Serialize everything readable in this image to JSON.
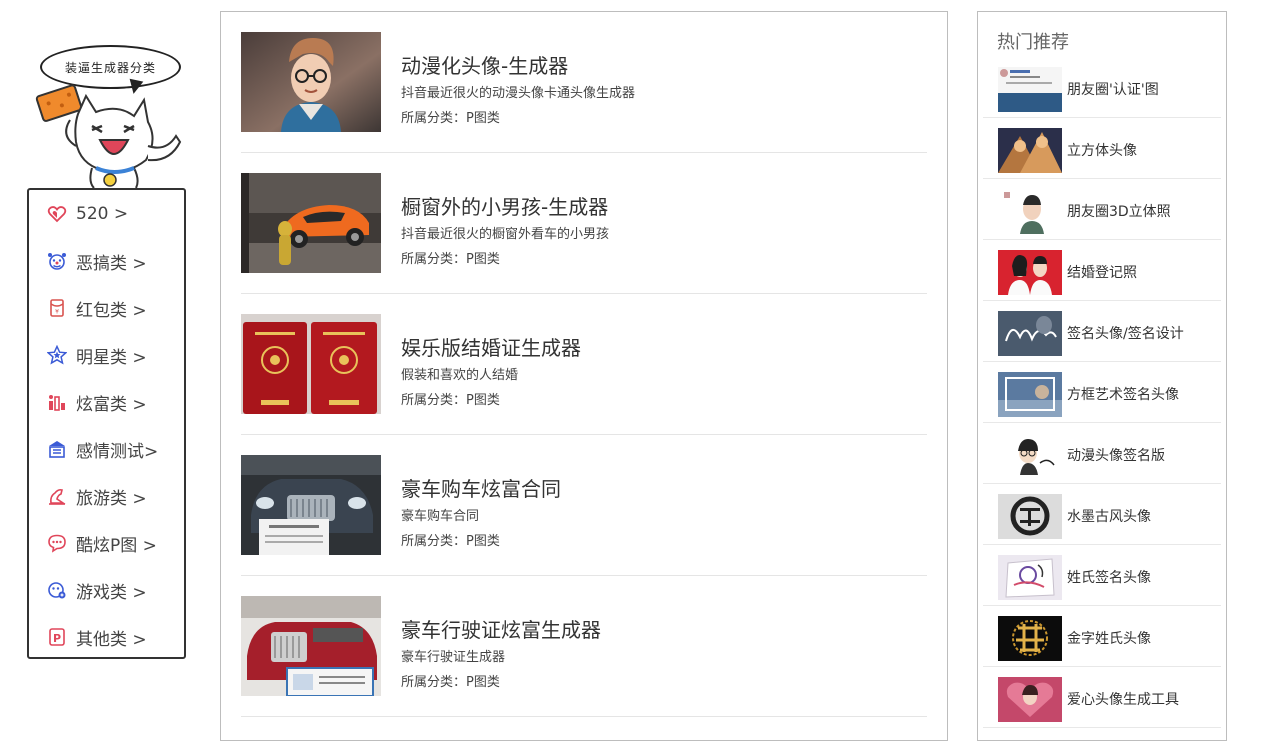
{
  "sidebar": {
    "bubble_text": "装逼生成器分类",
    "categories": [
      {
        "label": "520 >",
        "icon": "heart-icon",
        "color": "#e0465a"
      },
      {
        "label": "恶搞类 >",
        "icon": "clown-face-icon",
        "color": "#3b5bd6"
      },
      {
        "label": "红包类 >",
        "icon": "red-envelope-icon",
        "color": "#d9534f"
      },
      {
        "label": "明星类 >",
        "icon": "star-badge-icon",
        "color": "#3b5bd6"
      },
      {
        "label": "炫富类 >",
        "icon": "money-bars-icon",
        "color": "#e0465a"
      },
      {
        "label": "感情测试>",
        "icon": "building-icon",
        "color": "#3b5bd6"
      },
      {
        "label": "旅游类 >",
        "icon": "travel-icon",
        "color": "#e0465a"
      },
      {
        "label": "酷炫P图 >",
        "icon": "chat-bubble-icon",
        "color": "#e0465a"
      },
      {
        "label": "游戏类 >",
        "icon": "gamepad-icon",
        "color": "#3b5bd6"
      },
      {
        "label": "其他类 >",
        "icon": "p-badge-icon",
        "color": "#e0465a"
      }
    ]
  },
  "entries": [
    {
      "title": "动漫化头像-生成器",
      "desc": "抖音最近很火的动漫头像卡通头像生成器",
      "category": "所属分类：P图类"
    },
    {
      "title": "橱窗外的小男孩-生成器",
      "desc": "抖音最近很火的橱窗外看车的小男孩",
      "category": "所属分类：P图类"
    },
    {
      "title": "娱乐版结婚证生成器",
      "desc": "假装和喜欢的人结婚",
      "category": "所属分类：P图类"
    },
    {
      "title": "豪车购车炫富合同",
      "desc": "豪车购车合同",
      "category": "所属分类：P图类"
    },
    {
      "title": "豪车行驶证炫富生成器",
      "desc": "豪车行驶证生成器",
      "category": "所属分类：P图类"
    }
  ],
  "hot": {
    "title": "热门推荐",
    "items": [
      {
        "label": "朋友圈'认证'图"
      },
      {
        "label": "立方体头像"
      },
      {
        "label": "朋友圈3D立体照"
      },
      {
        "label": "结婚登记照"
      },
      {
        "label": "签名头像/签名设计"
      },
      {
        "label": "方框艺术签名头像"
      },
      {
        "label": "动漫头像签名版"
      },
      {
        "label": "水墨古风头像"
      },
      {
        "label": "姓氏签名头像"
      },
      {
        "label": "金字姓氏头像"
      },
      {
        "label": "爱心头像生成工具"
      }
    ]
  }
}
